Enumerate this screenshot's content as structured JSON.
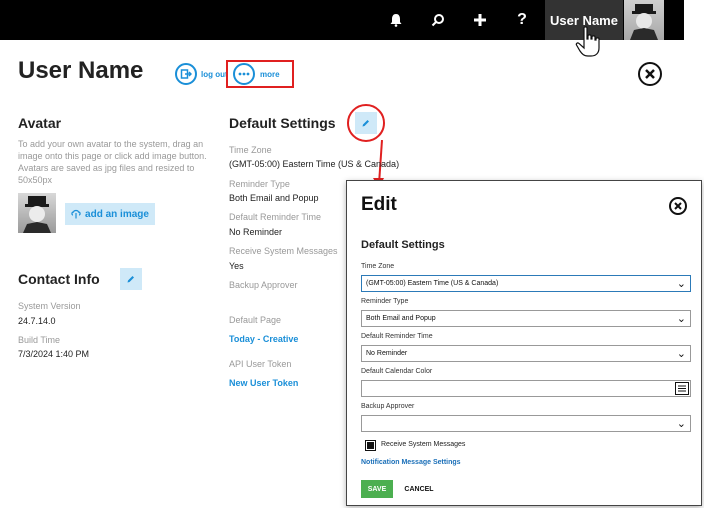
{
  "topbar": {
    "icons": [
      "bell-icon",
      "search-icon",
      "plus-icon",
      "help-icon"
    ],
    "help_glyph": "?",
    "user_name": "User Name"
  },
  "header": {
    "title": "User Name",
    "logout_label": "log out",
    "more_label": "more"
  },
  "avatar_section": {
    "title": "Avatar",
    "help_text": "To add your own avatar to the system, drag an image onto this page or click add image button. Avatars are saved as jpg files and resized to 50x50px",
    "add_image_label": "add an image"
  },
  "contact_section": {
    "title": "Contact Info",
    "system_version_label": "System Version",
    "system_version_value": "24.7.14.0",
    "build_time_label": "Build Time",
    "build_time_value": "7/3/2024 1:40 PM"
  },
  "default_settings": {
    "title": "Default Settings",
    "time_zone_label": "Time Zone",
    "time_zone_value": "(GMT-05:00) Eastern Time (US & Canada)",
    "reminder_type_label": "Reminder Type",
    "reminder_type_value": "Both Email and Popup",
    "default_reminder_time_label": "Default Reminder Time",
    "default_reminder_time_value": "No Reminder",
    "receive_system_messages_label": "Receive System Messages",
    "receive_system_messages_value": "Yes",
    "backup_approver_label": "Backup Approver",
    "default_page_label": "Default Page",
    "default_page_value": "Today - Creative",
    "api_user_token_label": "API User Token",
    "new_user_token_label": "New User Token"
  },
  "edit_dialog": {
    "title": "Edit",
    "subtitle": "Default Settings",
    "time_zone_label": "Time Zone",
    "time_zone_value": "(GMT-05:00) Eastern Time (US & Canada)",
    "reminder_type_label": "Reminder Type",
    "reminder_type_value": "Both Email and Popup",
    "default_reminder_time_label": "Default Reminder Time",
    "default_reminder_time_value": "No Reminder",
    "default_calendar_color_label": "Default Calendar Color",
    "backup_approver_label": "Backup Approver",
    "receive_system_messages_label": "Receive System Messages",
    "receive_system_messages_checked": true,
    "notification_link": "Notification Message Settings",
    "save_label": "SAVE",
    "cancel_label": "CANCEL"
  },
  "colors": {
    "accent": "#1a8fd8",
    "highlight_red": "#e02020",
    "save_green": "#4caf50",
    "topbar_bg": "#000000"
  }
}
